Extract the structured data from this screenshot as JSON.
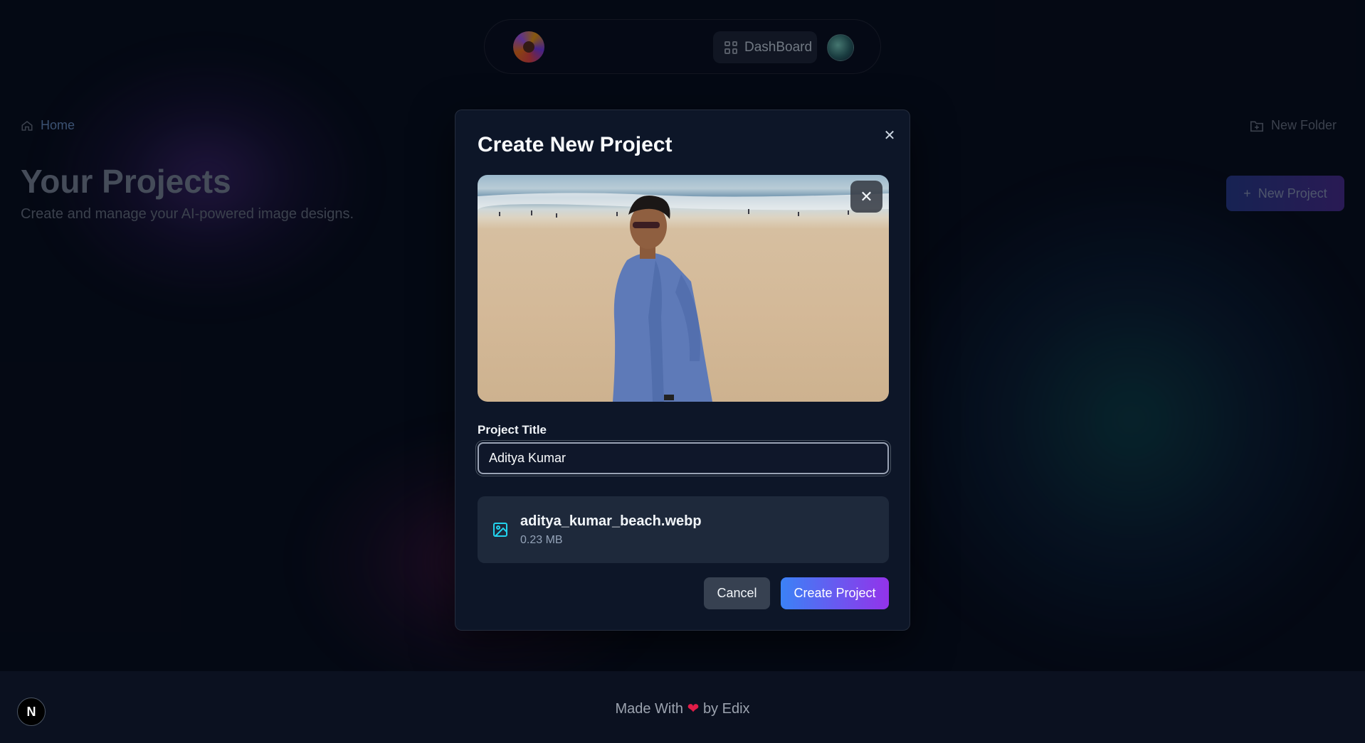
{
  "navbar": {
    "dashboard_label": "DashBoard",
    "logo_icon": "swirl-logo-icon",
    "avatar_icon": "user-avatar"
  },
  "page": {
    "breadcrumb_home": "Home",
    "title": "Your Projects",
    "subtitle": "Create and manage your AI-powered image designs.",
    "new_folder_label": "New Folder",
    "new_project_label": "New Project"
  },
  "modal": {
    "title": "Create New Project",
    "field_label": "Project Title",
    "title_value": "Aditya Kumar",
    "file": {
      "name": "aditya_kumar_beach.webp",
      "size": "0.23 MB"
    },
    "cancel_label": "Cancel",
    "create_label": "Create Project"
  },
  "footer": {
    "made_with": "Made With",
    "by": "by Edix",
    "badge": "N"
  },
  "colors": {
    "background": "#070b18",
    "modal": "#0d1628",
    "accent_start": "#3b82f6",
    "accent_end": "#9333ea",
    "file_icon": "#22d3ee",
    "heart": "#e11d48"
  }
}
